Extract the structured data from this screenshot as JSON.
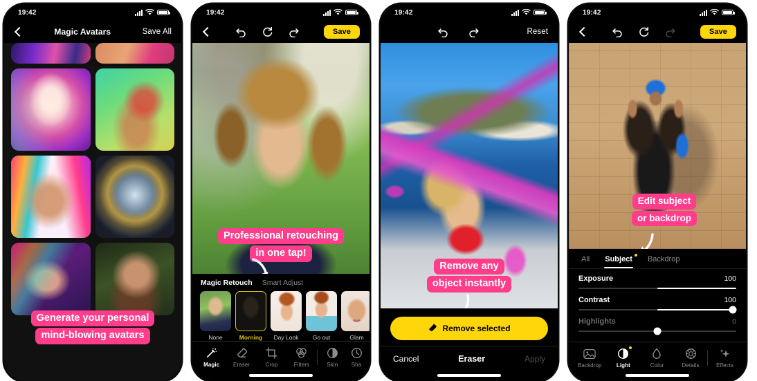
{
  "status": {
    "time": "19:42"
  },
  "panels": [
    {
      "id": "magic-avatars",
      "nav": {
        "back_icon": "chevron-left-icon",
        "title": "Magic Avatars",
        "right_label": "Save All"
      },
      "callout": {
        "line1": "Generate your personal",
        "line2": "mind-blowing avatars"
      }
    },
    {
      "id": "magic-retouch",
      "nav": {
        "back_icon": "chevron-left-icon",
        "undo_icon": "undo-icon",
        "reset_icon": "reset-icon",
        "redo_icon": "redo-icon",
        "save_label": "Save"
      },
      "callout": {
        "line1": "Professional retouching",
        "line2": "in one tap!"
      },
      "retouch_tabs": [
        {
          "label": "Magic Retouch",
          "active": true
        },
        {
          "label": "Smart Adjust",
          "active": false
        }
      ],
      "presets": [
        {
          "label": "None",
          "selected": false
        },
        {
          "label": "Morning",
          "selected": true
        },
        {
          "label": "Day Look",
          "selected": false
        },
        {
          "label": "Go out",
          "selected": false
        },
        {
          "label": "Glam",
          "selected": false
        }
      ],
      "tabbar": [
        {
          "label": "Magic",
          "icon": "magic-wand-icon",
          "active": true
        },
        {
          "label": "Eraser",
          "icon": "eraser-icon",
          "active": false
        },
        {
          "label": "Crop",
          "icon": "crop-icon",
          "active": false
        },
        {
          "label": "Filters",
          "icon": "filters-icon",
          "active": false
        },
        {
          "label": "Skin",
          "icon": "skin-icon",
          "active": false
        },
        {
          "label": "Sha",
          "icon": "shape-icon",
          "active": false
        }
      ]
    },
    {
      "id": "eraser",
      "nav": {
        "undo_icon": "undo-icon",
        "redo_icon": "redo-icon",
        "right_label": "Reset"
      },
      "callout": {
        "line1": "Remove any",
        "line2": "object instantly"
      },
      "remove_button": {
        "label": "Remove selected",
        "icon": "eraser-icon",
        "color": "#FFD60A"
      },
      "footer": {
        "cancel": "Cancel",
        "title": "Eraser",
        "apply": "Apply",
        "apply_disabled": true
      }
    },
    {
      "id": "light-adjust",
      "nav": {
        "back_icon": "chevron-left-icon",
        "undo_icon": "undo-icon",
        "reset_icon": "reset-icon",
        "redo_icon": "redo-icon",
        "redo_disabled": true,
        "save_label": "Save"
      },
      "callout": {
        "line1": "Edit subject",
        "line2": "or backdrop"
      },
      "segments": [
        {
          "label": "All",
          "active": false,
          "dot": false
        },
        {
          "label": "Subject",
          "active": true,
          "dot": true
        },
        {
          "label": "Backdrop",
          "active": false,
          "dot": false
        }
      ],
      "sliders": [
        {
          "label": "Exposure",
          "value": "100",
          "fill_start": 50,
          "fill_end": 100,
          "knob": null,
          "dim": false
        },
        {
          "label": "Contrast",
          "value": "100",
          "fill_start": 50,
          "fill_end": 100,
          "knob": 100,
          "dim": false
        },
        {
          "label": "Highlights",
          "value": "0",
          "fill_start": 0,
          "fill_end": 0,
          "knob": 50,
          "dim": true
        }
      ],
      "tabbar": [
        {
          "label": "Backdrop",
          "icon": "image-icon",
          "active": false
        },
        {
          "label": "Light",
          "icon": "light-icon",
          "active": true,
          "dot": true
        },
        {
          "label": "Color",
          "icon": "color-drop-icon",
          "active": false
        },
        {
          "label": "Details",
          "icon": "details-icon",
          "active": false
        },
        {
          "label": "Effects",
          "icon": "sparkle-icon",
          "active": false
        }
      ]
    }
  ],
  "colors": {
    "accent_yellow": "#FFD60A",
    "callout_pink": "#FF3D8B",
    "preset_selected": "#D9C40B"
  }
}
